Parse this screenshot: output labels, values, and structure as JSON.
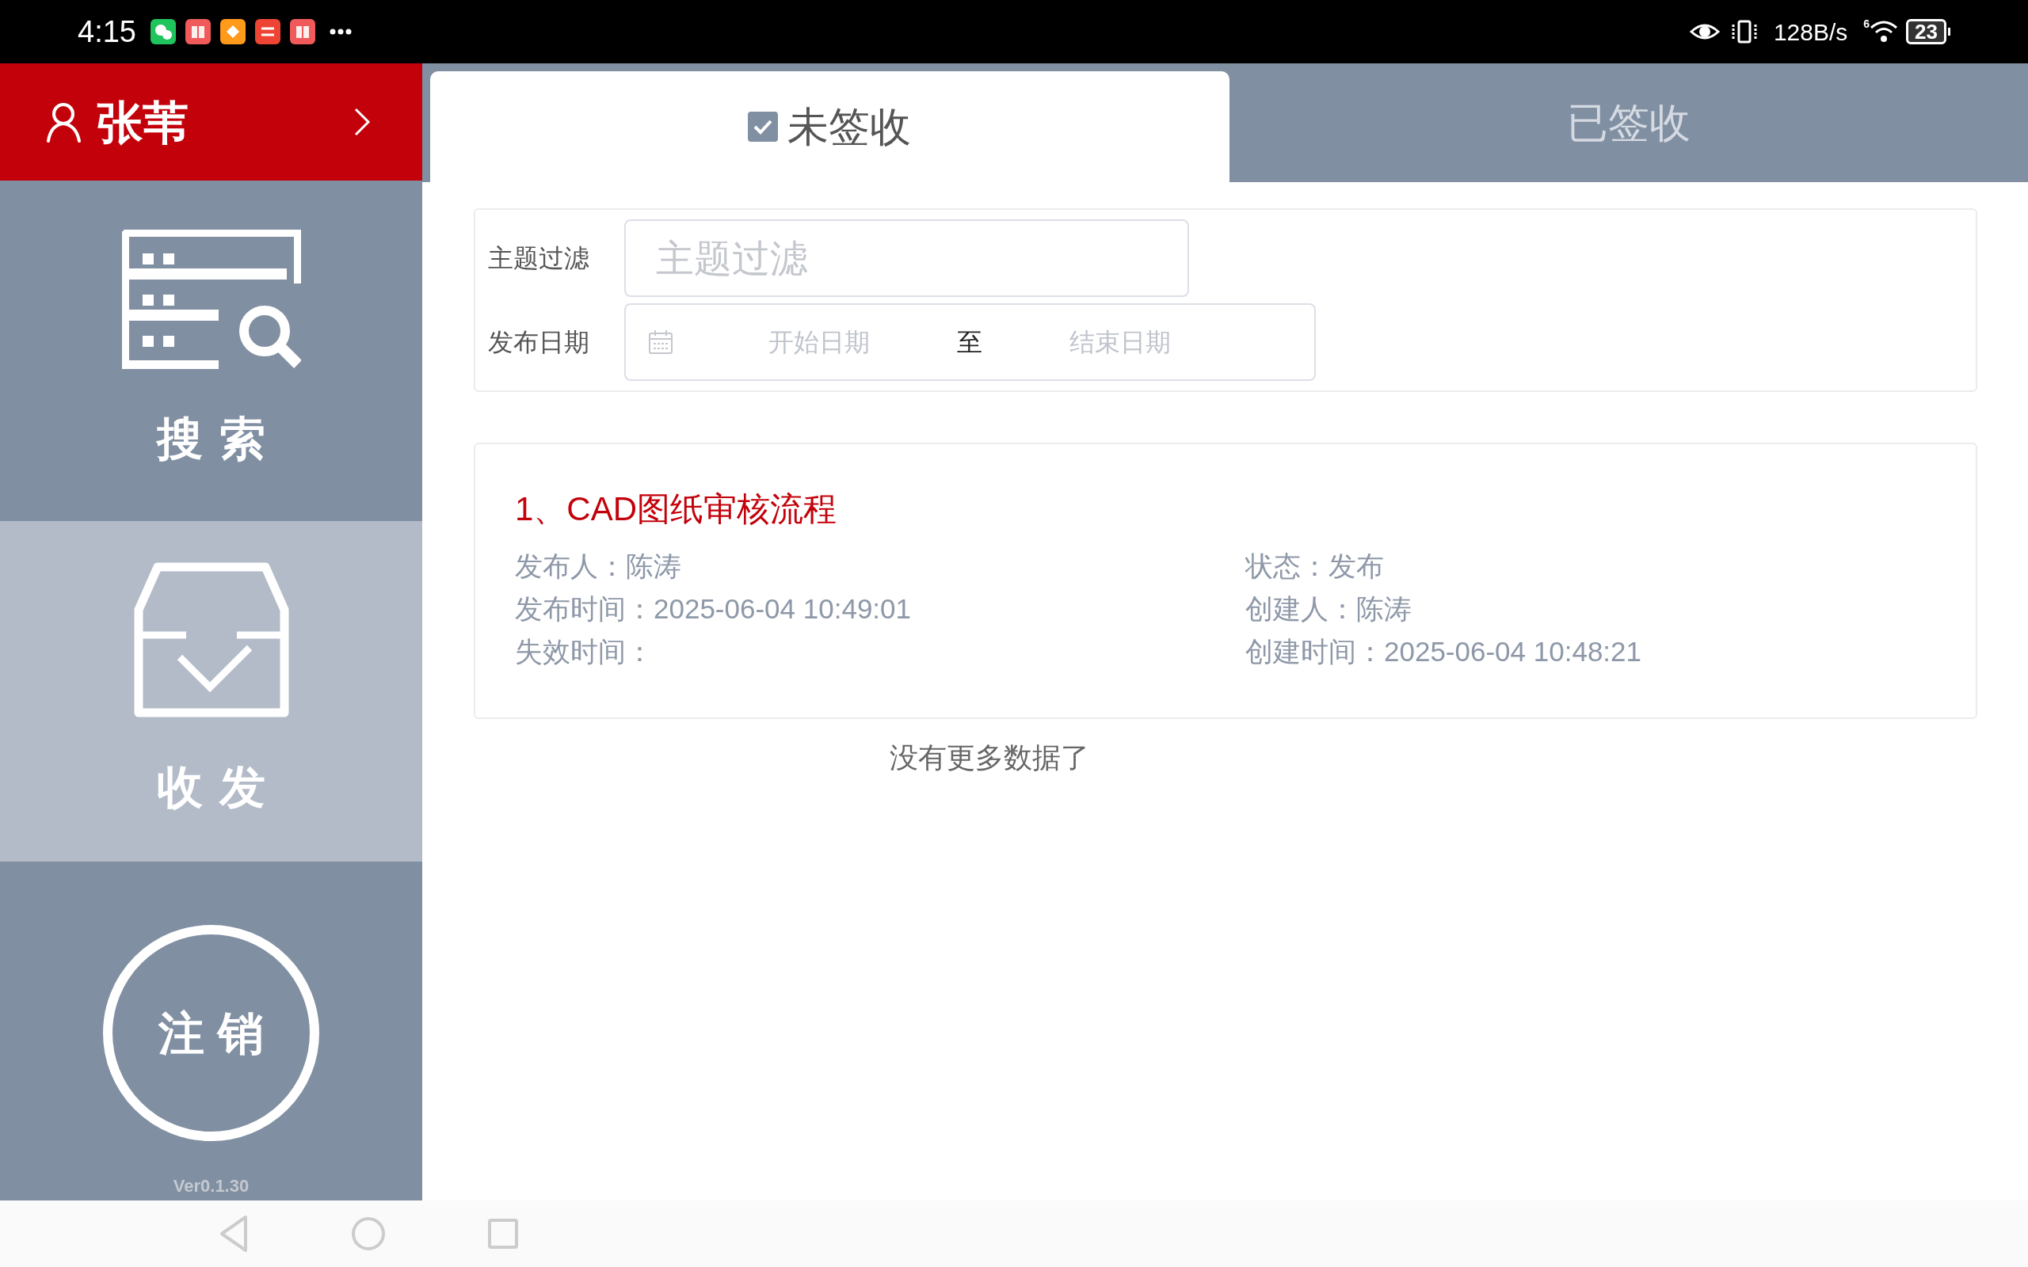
{
  "status_bar": {
    "time": "4:15",
    "wifi_standard": "6",
    "network_speed": "128B/s",
    "battery": "23"
  },
  "sidebar": {
    "user_name": "张苇",
    "items": [
      {
        "label": "搜索",
        "kind": "search",
        "selected": false
      },
      {
        "label": "收发",
        "kind": "inbox",
        "selected": true
      }
    ],
    "logout": "注销",
    "version": "Ver0.1.30"
  },
  "tabs": [
    {
      "label": "未签收",
      "selected": true
    },
    {
      "label": "已签收",
      "selected": false
    }
  ],
  "filters": {
    "subject": {
      "label": "主题过滤",
      "placeholder": "主题过滤"
    },
    "date": {
      "label": "发布日期",
      "start_placeholder": "开始日期",
      "separator": "至",
      "end_placeholder": "结束日期"
    }
  },
  "records": [
    {
      "title": "1、CAD图纸审核流程",
      "left": [
        {
          "label": "发布人：",
          "value": "陈涛"
        },
        {
          "label": "发布时间：",
          "value": "2025-06-04 10:49:01"
        },
        {
          "label": "失效时间："
        }
      ],
      "right": [
        {
          "label": "状态：",
          "value": "发布"
        },
        {
          "label": "创建人：",
          "value": "陈涛"
        },
        {
          "label": "创建时间：",
          "value": "2025-06-04 10:48:21"
        }
      ]
    }
  ],
  "footer_note": "没有更多数据了"
}
